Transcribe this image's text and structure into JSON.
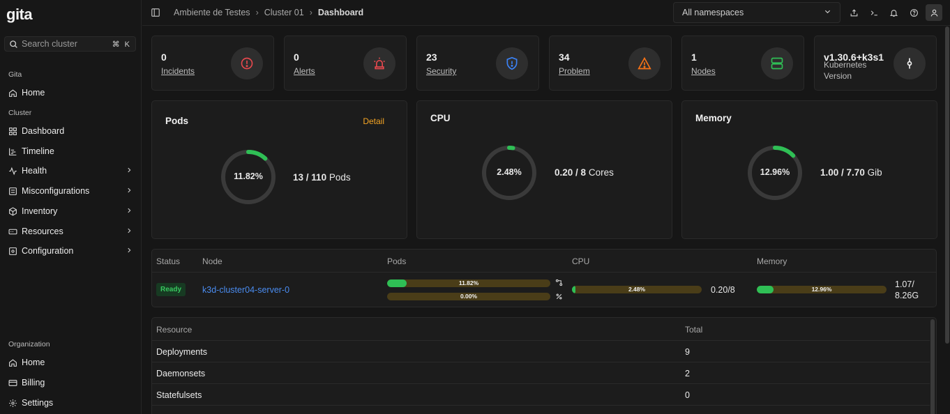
{
  "brand": {
    "logo_text": "gita"
  },
  "search": {
    "placeholder": "Search cluster",
    "shortcut": "⌘ K"
  },
  "sidebar": {
    "group_gita": "Gita",
    "gita_items": [
      {
        "label": "Home",
        "icon": "home-icon"
      }
    ],
    "group_cluster": "Cluster",
    "cluster_items": [
      {
        "label": "Dashboard",
        "icon": "grid-icon"
      },
      {
        "label": "Timeline",
        "icon": "timeline-icon"
      },
      {
        "label": "Health",
        "icon": "health-icon"
      },
      {
        "label": "Misconfigurations",
        "icon": "misconfig-icon"
      },
      {
        "label": "Inventory",
        "icon": "box-icon"
      },
      {
        "label": "Resources",
        "icon": "resources-icon"
      },
      {
        "label": "Configuration",
        "icon": "config-icon"
      }
    ],
    "group_org": "Organization",
    "org_items": [
      {
        "label": "Home",
        "icon": "home-icon"
      },
      {
        "label": "Billing",
        "icon": "billing-icon"
      },
      {
        "label": "Settings",
        "icon": "gear-icon"
      }
    ]
  },
  "breadcrumb": {
    "items": [
      "Ambiente de Testes",
      "Cluster 01",
      "Dashboard"
    ]
  },
  "namespace_select": {
    "value": "All namespaces"
  },
  "stats": [
    {
      "value": "0",
      "label": "Incidents",
      "icon": "alert-circle-icon",
      "color": "#e5484d"
    },
    {
      "value": "0",
      "label": "Alerts",
      "icon": "siren-icon",
      "color": "#e5484d"
    },
    {
      "value": "23",
      "label": "Security",
      "icon": "shield-icon",
      "color": "#3b82f6"
    },
    {
      "value": "34",
      "label": "Problem",
      "icon": "warning-icon",
      "color": "#f97316"
    },
    {
      "value": "1",
      "label": "Nodes",
      "icon": "server-icon",
      "color": "#2fbf55"
    },
    {
      "value": "v1.30.6+k3s1",
      "label": "Kubernetes Version",
      "icon": "git-commit-icon",
      "color": "#f2f2f2"
    }
  ],
  "gauges": {
    "pods": {
      "title": "Pods",
      "detail_label": "Detail",
      "percent": 11.82,
      "percent_label": "11.82%",
      "used": "13",
      "sep": " / ",
      "total": "110",
      "unit": " Pods"
    },
    "cpu": {
      "title": "CPU",
      "percent": 2.48,
      "percent_label": "2.48%",
      "used": "0.20",
      "sep": " / ",
      "total": "8",
      "unit": " Cores"
    },
    "memory": {
      "title": "Memory",
      "percent": 12.96,
      "percent_label": "12.96%",
      "used": "1.00",
      "sep": " / ",
      "total": "7.70",
      "unit": " Gib"
    }
  },
  "nodes_table": {
    "headers": [
      "Status",
      "Node",
      "Pods",
      "CPU",
      "Memory"
    ],
    "row": {
      "status": "Ready",
      "node": "k3d-cluster04-server-0",
      "pods_bar1": {
        "percent": 11.82,
        "label": "11.82%"
      },
      "pods_bar2": {
        "percent": 0.0,
        "label": "0.00%"
      },
      "cpu_bar": {
        "percent": 2.48,
        "label": "2.48%"
      },
      "cpu_value": "0.20/8",
      "mem_bar": {
        "percent": 12.96,
        "label": "12.96%"
      },
      "mem_value_1": "1.07/",
      "mem_value_2": "8.26G"
    }
  },
  "resource_table": {
    "headers": [
      "Resource",
      "Total"
    ],
    "rows": [
      {
        "name": "Deployments",
        "total": "9"
      },
      {
        "name": "Daemonsets",
        "total": "2"
      },
      {
        "name": "Statefulsets",
        "total": "0"
      }
    ]
  },
  "colors": {
    "accent": "#f5a524",
    "success": "#2fbf55",
    "link": "#4a8cf0",
    "track": "#3a3a3a"
  }
}
